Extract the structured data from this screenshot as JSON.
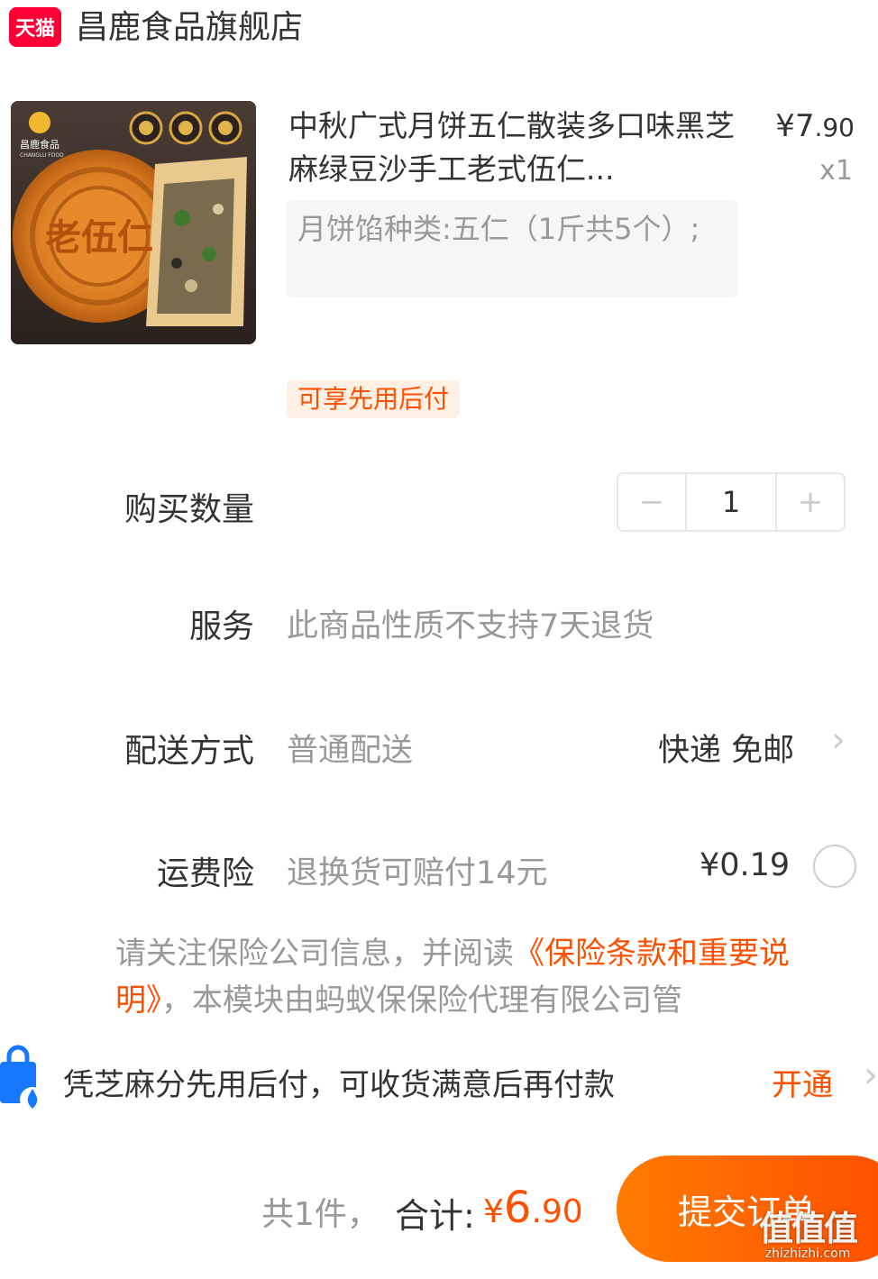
{
  "store": {
    "platform_logo_text": "天猫",
    "name": "昌鹿食品旗舰店"
  },
  "product": {
    "thumb_brand": "昌鹿食品",
    "thumb_brand_en": "CHANGLU FOOD",
    "thumb_stamp": "老伍仁",
    "title": "中秋广式月饼五仁散装多口味黑芝麻绿豆沙手工老式伍仁...",
    "price_symbol": "¥",
    "price_int": "7",
    "price_dec": ".90",
    "quantity_text": "x1",
    "sku": "月饼馅种类:五仁（1斤共5个）;",
    "pay_later_tag": "可享先用后付"
  },
  "rows": {
    "quantity_label": "购买数量",
    "quantity_value": "1",
    "minus": "−",
    "plus": "+",
    "service_label": "服务",
    "service_value": "此商品性质不支持7天退货",
    "delivery_label": "配送方式",
    "delivery_value": "普通配送",
    "delivery_option": "快递 免邮",
    "insurance_label": "运费险",
    "insurance_value": "退换货可赔付14元",
    "insurance_price": "¥0.19"
  },
  "notice": {
    "prefix": "请关注保险公司信息，并阅读",
    "link": "《保险条款和重要说明》",
    "suffix": "，本模块由蚂蚁保保险代理有限公司管"
  },
  "zhima": {
    "text": "凭芝麻分先用后付，可收货满意后再付款",
    "action": "开通"
  },
  "footer": {
    "count": "共1件，",
    "total_label": "合计:",
    "total_symbol": "¥",
    "total_int": "6",
    "total_dec": ".90",
    "submit": "提交订单"
  },
  "watermark": {
    "glyphs": "值值值",
    "url": "zhizhizhi.com"
  },
  "colors": {
    "accent": "#ff5000",
    "tmall_red": "#ff0036"
  }
}
